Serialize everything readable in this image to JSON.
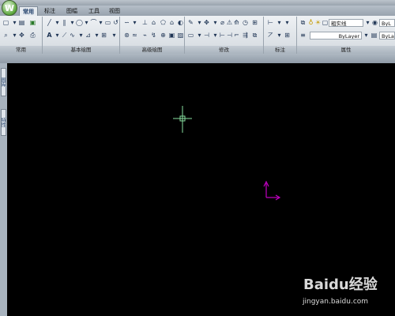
{
  "app": {
    "logo_letter": "W"
  },
  "tabs": [
    {
      "label": "常用",
      "active": true
    },
    {
      "label": "标注",
      "active": false
    },
    {
      "label": "图幅",
      "active": false
    },
    {
      "label": "工具",
      "active": false
    },
    {
      "label": "视图",
      "active": false
    }
  ],
  "panels": {
    "common": "常用",
    "basic_draw": "基本绘图",
    "advanced_draw": "高级绘图",
    "modify": "修改",
    "dimension": "标注",
    "properties": "属性"
  },
  "properties": {
    "linetype_layer": "粗实线",
    "linetype": "ByLayer",
    "layer_short": "ByL",
    "layer_color": "ByLa"
  },
  "sidebar": {
    "tab1": "图库",
    "tab2": "特性"
  },
  "canvas": {
    "background": "#000000",
    "crosshair_color": "#88e0a0",
    "ucs_color": "#c000c0"
  },
  "watermark": {
    "brand": "Baidu经验",
    "url": "jingyan.baidu.com"
  }
}
